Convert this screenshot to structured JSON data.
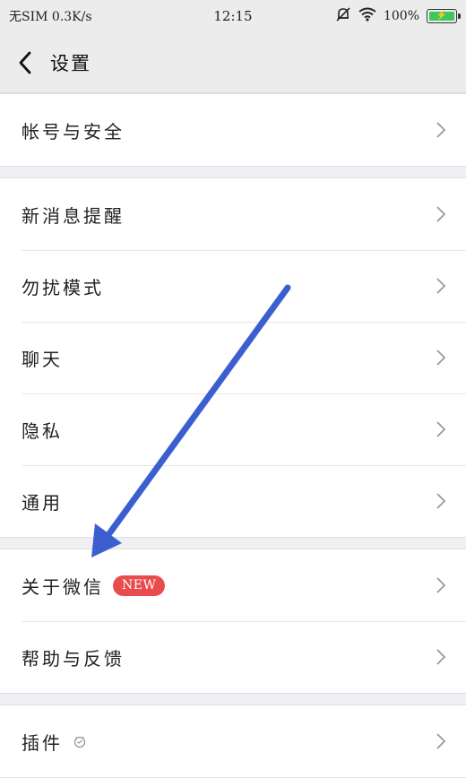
{
  "statusbar": {
    "carrier": "无SIM 0.3K/s",
    "time": "12:15",
    "battery": "100%",
    "icons": [
      "mute-bell-icon",
      "wifi-icon",
      "battery-icon"
    ]
  },
  "navbar": {
    "title": "设置",
    "back_icon": "chevron-left-icon"
  },
  "groups": [
    {
      "items": [
        {
          "label": "帐号与安全"
        }
      ]
    },
    {
      "items": [
        {
          "label": "新消息提醒"
        },
        {
          "label": "勿扰模式"
        },
        {
          "label": "聊天"
        },
        {
          "label": "隐私"
        },
        {
          "label": "通用"
        }
      ]
    },
    {
      "items": [
        {
          "label": "关于微信",
          "badge": "NEW"
        },
        {
          "label": "帮助与反馈"
        }
      ]
    },
    {
      "items": [
        {
          "label": "插件",
          "icon": "plugin-icon"
        }
      ]
    }
  ],
  "colors": {
    "badge": "#e84c4c",
    "annotation_arrow": "#3b5fcf",
    "battery": "#3ec85a"
  }
}
